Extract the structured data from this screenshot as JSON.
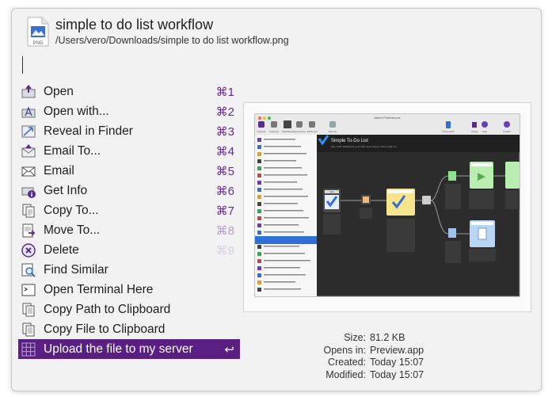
{
  "file": {
    "title": "simple to do list workflow",
    "path": "/Users/vero/Downloads/simple to do list workflow.png",
    "icon": "png-file-icon",
    "icon_text": "PNG"
  },
  "actions": [
    {
      "label": "Open",
      "shortcut": "⌘1",
      "icon": "folder-open-icon",
      "name": "open"
    },
    {
      "label": "Open with...",
      "shortcut": "⌘2",
      "icon": "app-open-with-icon",
      "name": "open-with"
    },
    {
      "label": "Reveal in Finder",
      "shortcut": "⌘3",
      "icon": "reveal-finder-icon",
      "name": "reveal-in-finder"
    },
    {
      "label": "Email To...",
      "shortcut": "⌘4",
      "icon": "email-to-icon",
      "name": "email-to"
    },
    {
      "label": "Email",
      "shortcut": "⌘5",
      "icon": "envelope-icon",
      "name": "email"
    },
    {
      "label": "Get Info",
      "shortcut": "⌘6",
      "icon": "info-icon",
      "name": "get-info"
    },
    {
      "label": "Copy To...",
      "shortcut": "⌘7",
      "icon": "copy-document-icon",
      "name": "copy-to"
    },
    {
      "label": "Move To...",
      "shortcut": "⌘8",
      "icon": "move-document-icon",
      "name": "move-to"
    },
    {
      "label": "Delete",
      "shortcut": "⌘9",
      "icon": "delete-icon",
      "name": "delete"
    },
    {
      "label": "Find Similar",
      "shortcut": "",
      "icon": "find-similar-icon",
      "name": "find-similar"
    },
    {
      "label": "Open Terminal Here",
      "shortcut": "",
      "icon": "terminal-icon",
      "name": "open-terminal-here"
    },
    {
      "label": "Copy Path to Clipboard",
      "shortcut": "",
      "icon": "clipboard-icon",
      "name": "copy-path"
    },
    {
      "label": "Copy File to Clipboard",
      "shortcut": "",
      "icon": "clipboard-icon",
      "name": "copy-file"
    },
    {
      "label": "Upload the file to my server",
      "shortcut": "↩",
      "icon": "upload-grid-icon",
      "name": "upload-to-server"
    }
  ],
  "selected_index": 13,
  "preview": {
    "window_title": "Alfred Preferences",
    "toolbar_items": [
      "General",
      "Features",
      "Workflows",
      "Appearance",
      "Advanced",
      "Remote"
    ],
    "toolbar_right": [
      "Powerpack",
      "Usage",
      "Help",
      "Update"
    ],
    "workflow_title": "Simple To-Do List",
    "workflow_subtitle": "Use \"todo\" followed by your task, then choose a list to add it to",
    "node_labels": [
      "todo",
      "",
      "Write to List",
      "Create Task"
    ],
    "node_texts": [
      "Keyword",
      "Arg & Vars",
      "List Filter",
      "Copy to Clipboard",
      "Post Notification"
    ]
  },
  "info": {
    "size_label": "Size:",
    "size": "81.2 KB",
    "opens_label": "Opens in:",
    "opens": "Preview.app",
    "created_label": "Created:",
    "created": "Today 15:07",
    "modified_label": "Modified:",
    "modified": "Today 15:07"
  },
  "colors": {
    "accent": "#5a1f83",
    "shortcut": "#6a2a96"
  }
}
